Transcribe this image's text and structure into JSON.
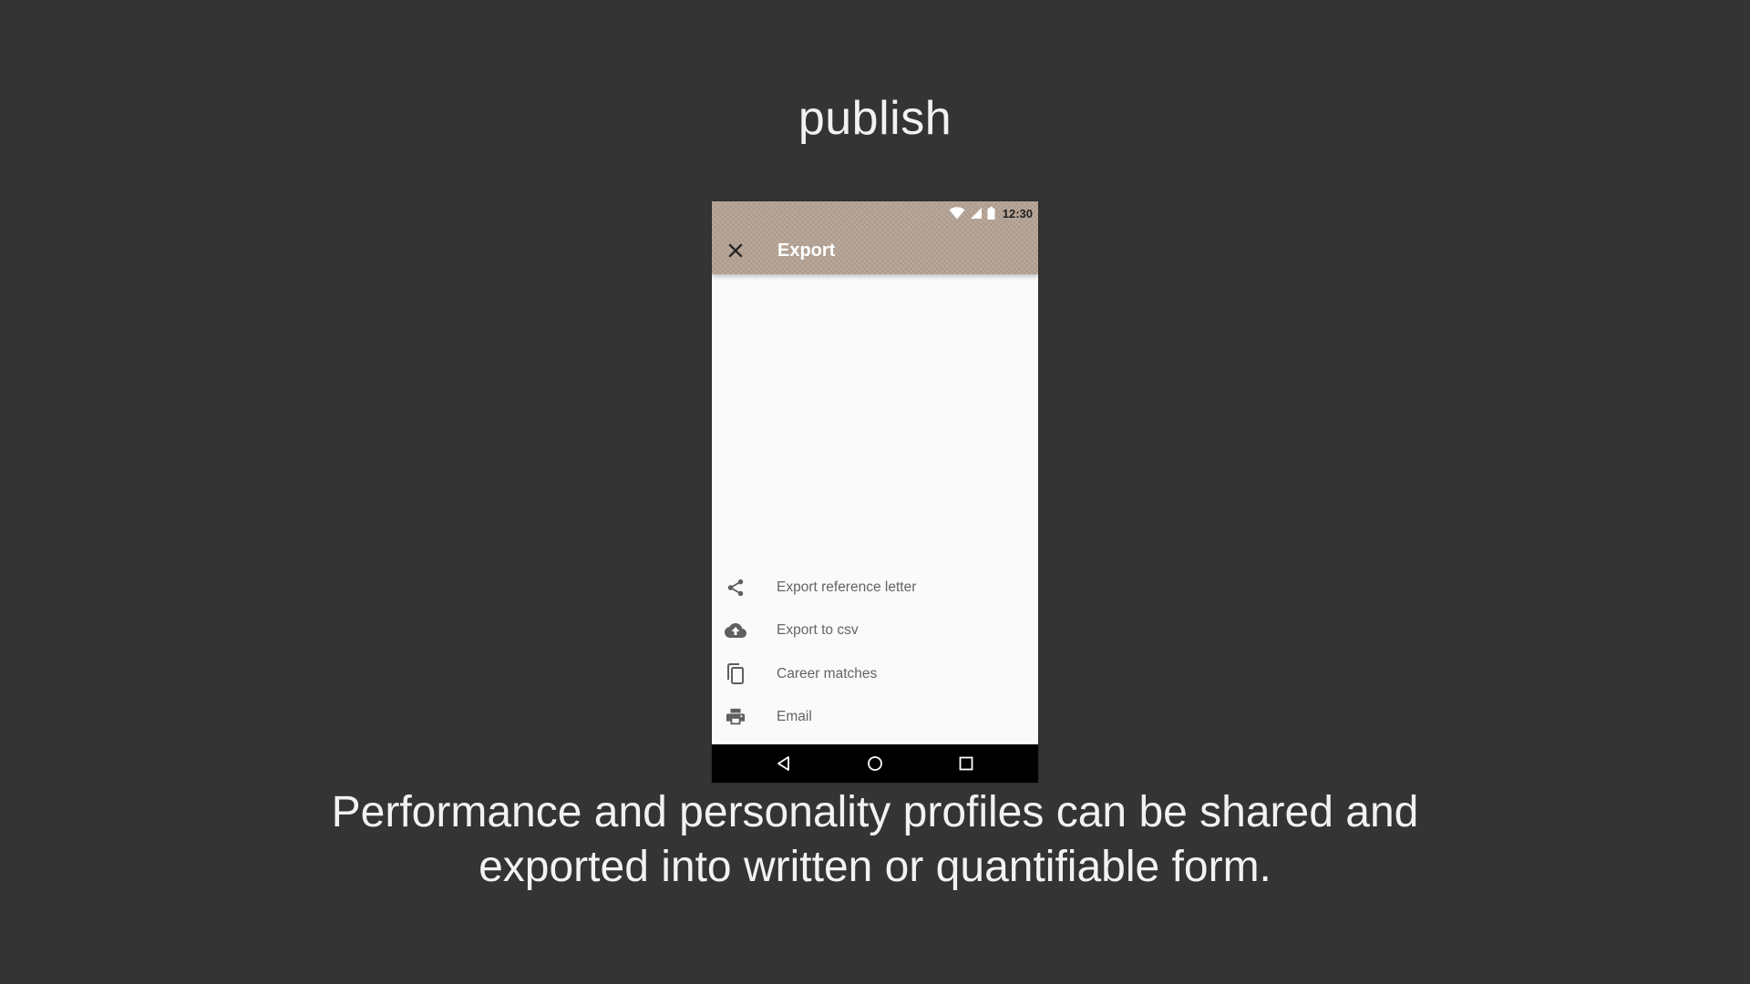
{
  "slide": {
    "title": "publish",
    "caption": "Performance and personality profiles can be shared and exported into written or quantifiable form."
  },
  "phone": {
    "status_bar": {
      "time": "12:30",
      "icons": [
        "wifi-icon",
        "signal-icon",
        "battery-icon"
      ]
    },
    "app_bar": {
      "close_icon": "close-icon",
      "title": "Export",
      "background_color": "#b6a394"
    },
    "menu": [
      {
        "icon": "share-icon",
        "label": "Export reference letter"
      },
      {
        "icon": "cloud-upload-icon",
        "label": "Export to csv"
      },
      {
        "icon": "copy-icon",
        "label": "Career matches"
      },
      {
        "icon": "print-icon",
        "label": "Email"
      }
    ],
    "nav_bar": {
      "buttons": [
        "back-icon",
        "home-icon",
        "recents-icon"
      ]
    }
  },
  "colors": {
    "background": "#343434",
    "text_light": "#f2f2f2",
    "menu_text": "#646464",
    "icon": "#5f5f5f"
  }
}
